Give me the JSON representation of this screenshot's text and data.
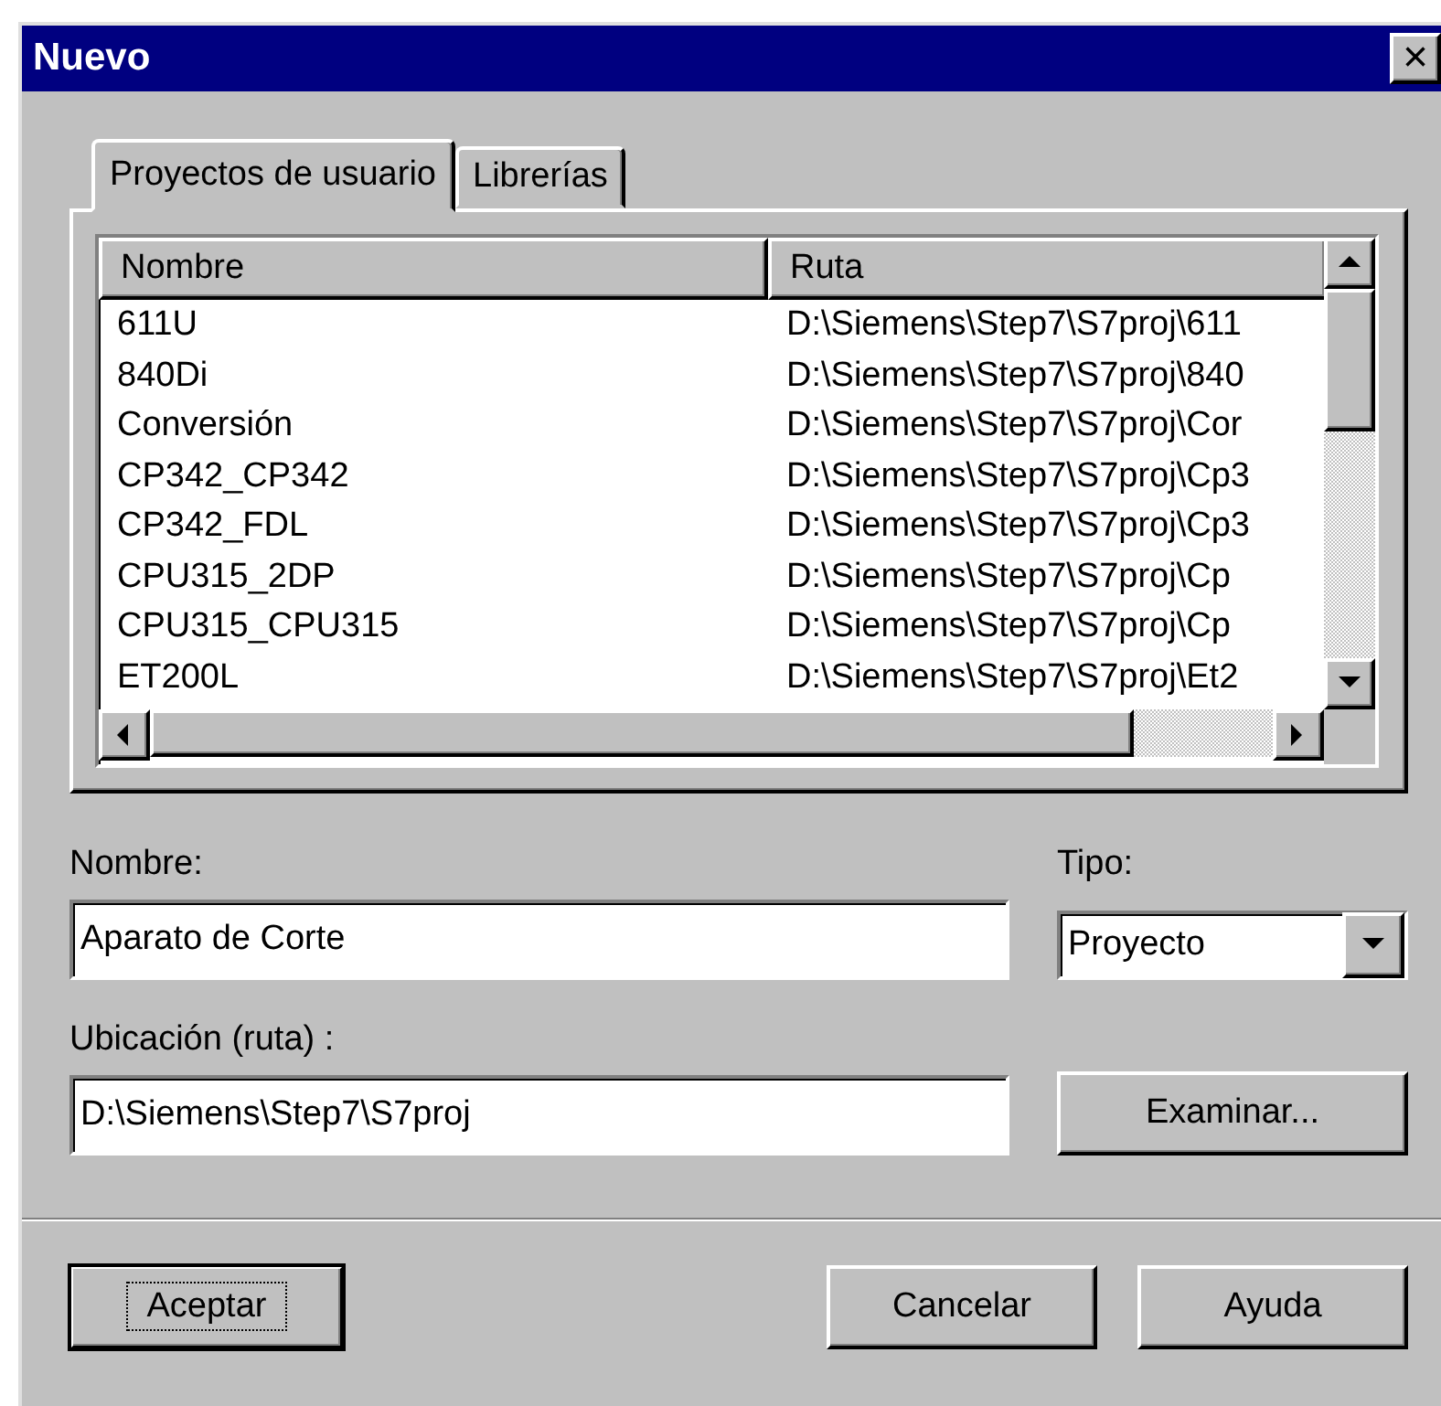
{
  "window": {
    "title": "Nuevo",
    "close": "×"
  },
  "tabs": [
    {
      "label": "Proyectos de usuario",
      "selected": true
    },
    {
      "label": "Librerías",
      "selected": false
    }
  ],
  "table": {
    "columns": [
      "Nombre",
      "Ruta"
    ],
    "rows": [
      [
        "611U",
        "D:\\Siemens\\Step7\\S7proj\\611"
      ],
      [
        "840Di",
        "D:\\Siemens\\Step7\\S7proj\\840"
      ],
      [
        "Conversión",
        "D:\\Siemens\\Step7\\S7proj\\Cor"
      ],
      [
        "CP342_CP342",
        "D:\\Siemens\\Step7\\S7proj\\Cp3"
      ],
      [
        "CP342_FDL",
        "D:\\Siemens\\Step7\\S7proj\\Cp3"
      ],
      [
        "CPU315_2DP",
        "D:\\Siemens\\Step7\\S7proj\\Cp"
      ],
      [
        "CPU315_CPU315",
        "D:\\Siemens\\Step7\\S7proj\\Cp"
      ],
      [
        "ET200L",
        "D:\\Siemens\\Step7\\S7proj\\Et2"
      ]
    ]
  },
  "name_field": {
    "label": "Nombre:",
    "value": "Aparato de Corte"
  },
  "type_field": {
    "label": "Tipo:",
    "value": "Proyecto"
  },
  "location_field": {
    "label": "Ubicación (ruta) :",
    "value": "D:\\Siemens\\Step7\\S7proj"
  },
  "browse_button": {
    "label": "Examinar..."
  },
  "buttons": [
    {
      "label": "Aceptar",
      "default": true
    },
    {
      "label": "Cancelar",
      "default": false
    },
    {
      "label": "Ayuda",
      "default": false
    }
  ]
}
